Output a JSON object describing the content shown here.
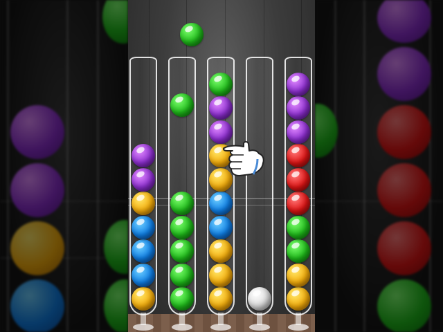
{
  "colors": {
    "green": "#1fbb1a",
    "purple": "#8d2fd0",
    "orange": "#f5ae0c",
    "blue": "#0f7fe6",
    "red": "#e01515",
    "white": "#dcdcdc"
  },
  "floating_ball": "green",
  "tubes": [
    {
      "balls_bottom_to_top": [
        "orange",
        "blue",
        "blue",
        "blue",
        "orange",
        "purple",
        "purple"
      ]
    },
    {
      "balls_bottom_to_top": [
        "green",
        "green",
        "green",
        "green",
        "green"
      ],
      "lifted_ball": "green"
    },
    {
      "balls_bottom_to_top": [
        "orange",
        "orange",
        "orange",
        "blue",
        "blue",
        "orange",
        "orange",
        "purple",
        "purple",
        "green"
      ]
    },
    {
      "balls_bottom_to_top": [
        "white"
      ]
    },
    {
      "balls_bottom_to_top": [
        "orange",
        "orange",
        "green",
        "green",
        "red",
        "red",
        "red",
        "purple",
        "purple",
        "purple"
      ]
    }
  ],
  "hint": {
    "icon": "pointing-hand-icon",
    "target_tube": 3
  }
}
